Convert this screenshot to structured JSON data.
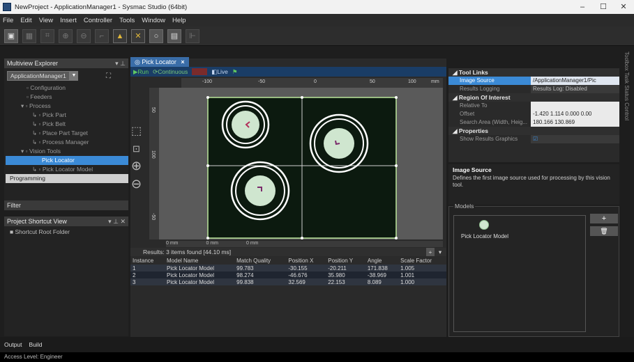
{
  "window": {
    "title": "NewProject - ApplicationManager1 - Sysmac Studio (64bit)",
    "min": "–",
    "max": "☐",
    "close": "✕"
  },
  "menu": [
    "File",
    "Edit",
    "View",
    "Insert",
    "Controller",
    "Tools",
    "Window",
    "Help"
  ],
  "multiview": {
    "title": "Multiview Explorer",
    "pin": "▾ ⊥",
    "app_select": "ApplicationManager1",
    "tree": [
      {
        "label": "▫ Configuration",
        "indent": 2
      },
      {
        "label": "▫ Feeders",
        "indent": 2
      },
      {
        "label": "▾ ▫ Process",
        "indent": 1
      },
      {
        "label": "↳ ▫ Pick Part",
        "indent": 3
      },
      {
        "label": "↳ ▫ Pick Belt",
        "indent": 3
      },
      {
        "label": "↳ ▫ Place Part Target",
        "indent": 3
      },
      {
        "label": "↳ ▫ Process Manager",
        "indent": 3
      },
      {
        "label": "▾ ▫ Vision Tools",
        "indent": 1
      },
      {
        "label": "Pick Locator",
        "indent": 3,
        "selected": true
      },
      {
        "label": "↳ ▫ Pick Locator Model",
        "indent": 3
      }
    ],
    "programming": "Programming",
    "filter": "Filter"
  },
  "shortcut": {
    "title": "Project Shortcut View",
    "pin": "▾ ⊥ ✕",
    "root": "Shortcut Root Folder"
  },
  "doc": {
    "tab": "Pick Locator",
    "tab_close": "×",
    "run": "Run",
    "continuous": "Continuous",
    "stop": "■",
    "live": "Live",
    "ruler_top": [
      "-100",
      "-50",
      "0",
      "50",
      "100"
    ],
    "ruler_left": [
      "50",
      "100",
      "0",
      "-50"
    ],
    "ruler_unit": "mm",
    "bottom_units": [
      "0 mm",
      "0 mm",
      "0 mm"
    ]
  },
  "results": {
    "summary": "Results: 3 items found [44.10 ms]",
    "columns": [
      "Instance",
      "Model Name",
      "Match Quality",
      "Position X",
      "Position Y",
      "Angle",
      "Scale Factor"
    ],
    "rows": [
      [
        "1",
        "Pick Locator Model",
        "99.783",
        "-30.155",
        "-20.211",
        "171.838",
        "1.005"
      ],
      [
        "2",
        "Pick Locator Model",
        "98.274",
        "-46.676",
        "35.980",
        "-38.969",
        "1.001"
      ],
      [
        "3",
        "Pick Locator Model",
        "99.838",
        "32.569",
        "22.153",
        "8.089",
        "1.000"
      ]
    ]
  },
  "props": {
    "s1": "Tool Links",
    "image_source_k": "Image Source",
    "image_source_v": "/ApplicationManager1/Pic",
    "results_logging_k": "Results Logging",
    "results_logging_v": "Results Log: Disabled",
    "s2": "Region Of Interest",
    "relative_to_k": "Relative To",
    "offset_k": "Offset",
    "offset_v": "-1.420 1.114 0.000 0.00",
    "search_area_k": "Search Area (Width, Heig...",
    "search_area_v": "180.166 130.869",
    "s3": "Properties",
    "show_graphics_k": "Show Results Graphics",
    "show_graphics_v": "☑"
  },
  "desc": {
    "heading": "Image Source",
    "text": "Defines the first image source used for processing by this vision tool."
  },
  "models": {
    "label": "Models",
    "item": "Pick Locator Model",
    "add": "+",
    "delete": "🗑"
  },
  "bottom": {
    "tab_output": "Output",
    "tab_build": "Build",
    "status": "Access Level: Engineer"
  },
  "toolbox_side": "Toolbox  Task  Status  Control"
}
